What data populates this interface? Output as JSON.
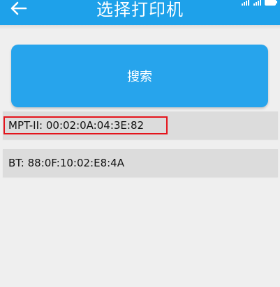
{
  "header": {
    "title": "选择打印机",
    "back_icon": "arrow-left-icon",
    "background_color": "#1ea1ea"
  },
  "status_bar": {
    "icons": [
      "signal-icon",
      "signal-icon",
      "battery-icon"
    ]
  },
  "search_button": {
    "label": "搜索",
    "background_color": "#27a4ec"
  },
  "devices": [
    {
      "label": "MPT-II: 00:02:0A:04:3E:82",
      "selected": true
    },
    {
      "label": "BT: 88:0F:10:02:E8:4A",
      "selected": false
    }
  ],
  "colors": {
    "selection_border": "#e4141c",
    "list_item_background": "#dcdcdc",
    "page_background": "#efefef"
  }
}
